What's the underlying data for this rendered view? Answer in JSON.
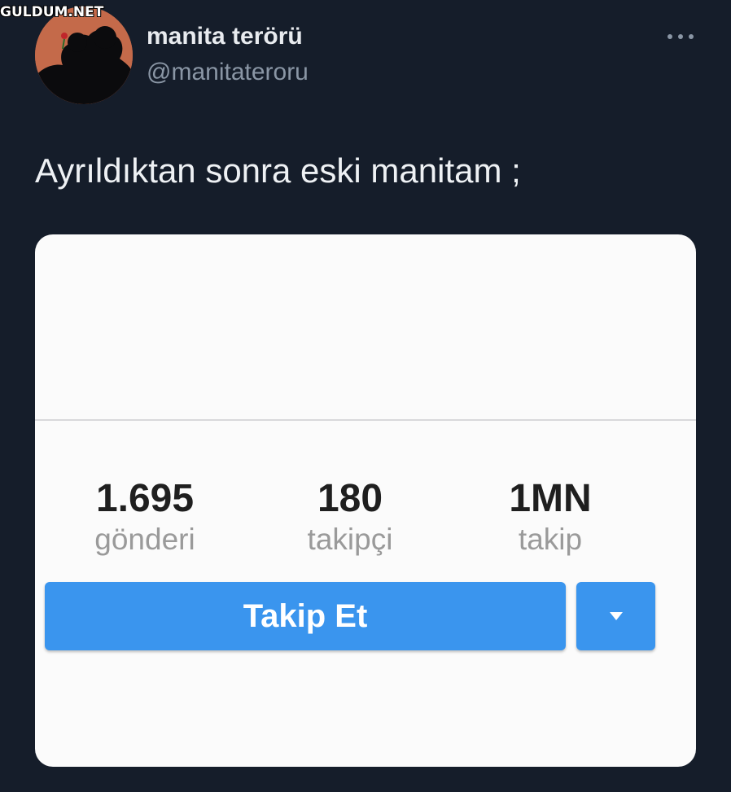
{
  "watermark": "GULDUM.NET",
  "tweet": {
    "display_name": "manita terörü",
    "handle": "@manitateroru",
    "text": "Ayrıldıktan sonra eski manitam ;"
  },
  "profile_card": {
    "stats": [
      {
        "value": "1.695",
        "label": "gönderi"
      },
      {
        "value": "180",
        "label": "takipçi"
      },
      {
        "value": "1MN",
        "label": "takip"
      }
    ],
    "follow_label": "Takip Et"
  },
  "colors": {
    "background": "#151d2a",
    "card": "#fbfbfb",
    "follow_button": "#3a95ee",
    "avatar": "#c46a4a"
  },
  "icons": {
    "more": "more-horizontal-icon",
    "dropdown": "triangle-down-icon"
  }
}
